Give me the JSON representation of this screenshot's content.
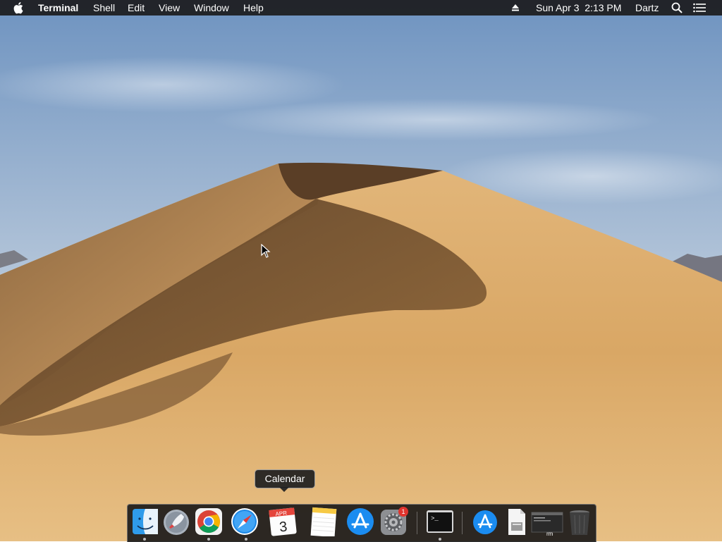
{
  "menubar": {
    "apple_icon": "apple-icon",
    "app_name": "Terminal",
    "menus": [
      "Shell",
      "Edit",
      "View",
      "Window",
      "Help"
    ],
    "status": {
      "eject_icon": "eject-icon",
      "datetime": "Sun Apr 3  2:13 PM",
      "user": "Dartz",
      "spotlight_icon": "magnifying-glass-icon",
      "notification_icon": "list-icon"
    }
  },
  "dock": {
    "tooltip": "Calendar",
    "apps": [
      {
        "name": "Finder",
        "icon": "finder-icon",
        "running": true
      },
      {
        "name": "Launchpad",
        "icon": "rocket-icon",
        "running": false
      },
      {
        "name": "Google Chrome",
        "icon": "chrome-icon",
        "running": true
      },
      {
        "name": "Safari",
        "icon": "compass-icon",
        "running": true
      },
      {
        "name": "Calendar",
        "icon": "calendar-icon",
        "running": false,
        "month": "APR",
        "day": "3"
      },
      {
        "name": "Notes",
        "icon": "notepad-icon",
        "running": false
      },
      {
        "name": "App Store",
        "icon": "app-store-icon",
        "running": false
      },
      {
        "name": "System Preferences",
        "icon": "gear-icon",
        "running": false,
        "badge": "1"
      },
      {
        "name": "Terminal",
        "icon": "terminal-icon",
        "running": true,
        "prompt": ">_"
      }
    ],
    "others": [
      {
        "name": "Applications",
        "icon": "app-store-folder-icon"
      },
      {
        "name": "Document",
        "icon": "document-icon"
      },
      {
        "name": "Terminal window",
        "icon": "terminal-window-icon",
        "caption": "rm"
      },
      {
        "name": "Trash",
        "icon": "trash-icon"
      }
    ]
  },
  "colors": {
    "sky_top": "#6e93c0",
    "sky_bottom": "#dfe4ea",
    "sand_light": "#d9a96a",
    "sand_dark": "#6b4a2c",
    "menubar_bg": "#1c1c1e",
    "badge": "#e0342e"
  }
}
